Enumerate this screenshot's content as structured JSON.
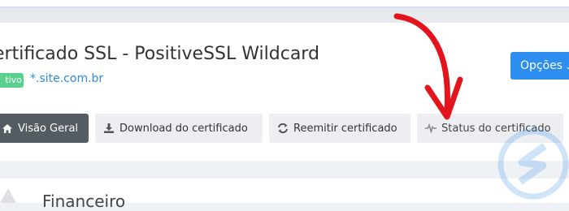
{
  "header": {
    "title": "ertificado SSL - PositiveSSL Wildcard",
    "status_badge": "tivo",
    "domain": "*.site.com.br"
  },
  "options_button": {
    "label": "Opções",
    "caret": "⌄"
  },
  "tabs": [
    {
      "label": "Visão Geral",
      "icon": "home-icon",
      "active": true
    },
    {
      "label": "Download do certificado",
      "icon": "download-icon",
      "active": false
    },
    {
      "label": "Reemitir certificado",
      "icon": "refresh-icon",
      "active": false
    },
    {
      "label": "Status do certificado",
      "icon": "pulse-icon",
      "active": false
    }
  ],
  "section": {
    "title": "Financeiro"
  },
  "overlay": {
    "arrow_color": "#e3141b",
    "watermark_color": "#2d8ae6"
  }
}
